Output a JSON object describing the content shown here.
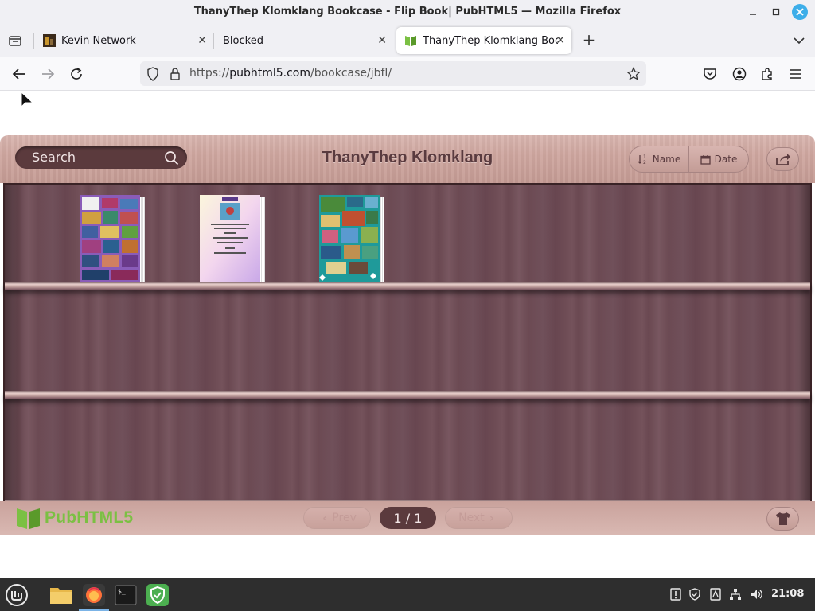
{
  "window": {
    "title": "ThanyThep Klomklang Bookcase - Flip Book| PubHTML5 — Mozilla Firefox",
    "minimize_icon": "minimize-icon",
    "maximize_icon": "maximize-icon",
    "close_icon": "close-icon"
  },
  "tabs": [
    {
      "label": "Kevin Network",
      "favicon": "kevin-network-favicon",
      "active": false
    },
    {
      "label": "Blocked",
      "favicon": "none",
      "active": false
    },
    {
      "label": "ThanyThep Klomklang Book",
      "favicon": "pubhtml5-book-favicon",
      "active": true
    }
  ],
  "tab_close_glyph": "✕",
  "newtab_glyph": "+",
  "nav": {
    "url_scheme": "https://",
    "url_host": "pubhtml5.com",
    "url_path": "/bookcase/jbfl/"
  },
  "bookcase": {
    "search_placeholder": "Search",
    "title": "ThanyThep Klomklang",
    "sort_name_label": "Name",
    "sort_date_label": "Date",
    "books": [
      {
        "name": "book-cover-1",
        "cover_style": "purple-collage"
      },
      {
        "name": "book-cover-2",
        "cover_style": "pastel-document"
      },
      {
        "name": "book-cover-3",
        "cover_style": "teal-collage"
      }
    ],
    "logo_text": "PubHTML5",
    "prev_label": "Prev",
    "next_label": "Next",
    "page_indicator": "1 / 1"
  },
  "taskbar": {
    "clock": "21:08",
    "apps": [
      "mint-menu-icon",
      "files-icon",
      "firefox-icon",
      "terminal-icon",
      "shield-app-icon"
    ]
  },
  "colors": {
    "wood_light": "#d9b6b0",
    "wood_dark": "#6e4c55",
    "accent_green": "#7bc043",
    "search_bg": "#5b3a3d"
  }
}
